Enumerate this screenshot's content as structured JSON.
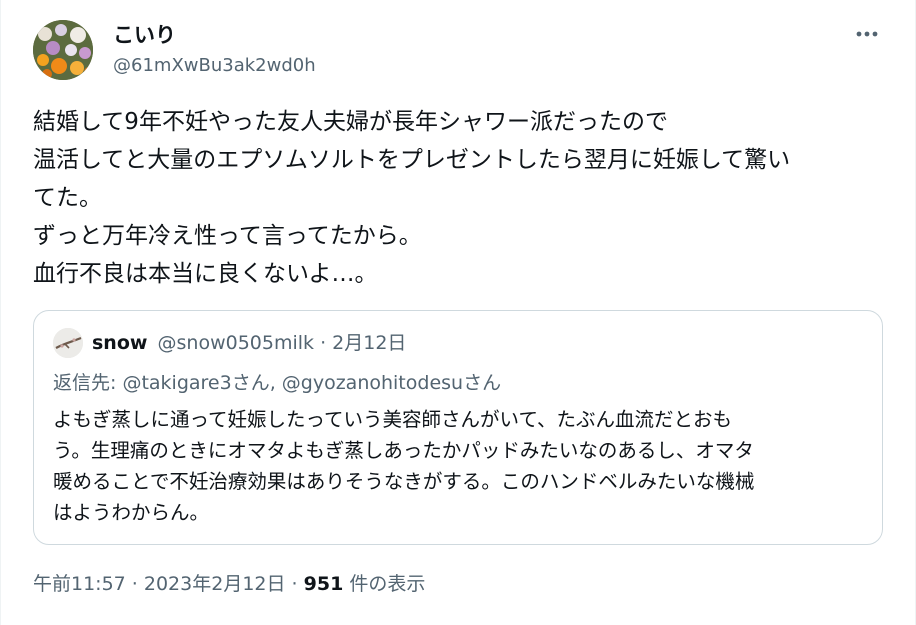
{
  "author": {
    "display_name": "こいり",
    "handle": "@61mXwBu3ak2wd0h"
  },
  "tweet": {
    "lines": [
      "結婚して9年不妊やった友人夫婦が長年シャワー派だったので",
      "温活してと大量のエプソムソルトをプレゼントしたら翌月に妊娠して驚い",
      "てた。",
      "ずっと万年冷え性って言ってたから。",
      "血行不良は本当に良くないよ…。"
    ]
  },
  "quoted_tweet": {
    "display_name": "snow",
    "handle_and_date": "@snow0505milk · 2月12日",
    "reply_to": "返信先: @takigare3さん, @gyozanohitodesuさん",
    "lines": [
      "よもぎ蒸しに通って妊娠したっていう美容師さんがいて、たぶん血流だとおも",
      "う。生理痛のときにオマタよもぎ蒸しあったかパッドみたいなのあるし、オマタ",
      "暖めることで不妊治療効果はありそうなきがする。このハンドベルみたいな機械",
      "はようわからん。"
    ]
  },
  "footer": {
    "timestamp": "午前11:57 · 2023年2月12日",
    "separator": " · ",
    "views_count": "951",
    "views_label": " 件の表示"
  },
  "icons": {
    "more": "more-horizontal-icon",
    "avatar": "flower-photo-avatar",
    "quote_avatar": "branch-photo-avatar"
  },
  "colors": {
    "text": "#0f1419",
    "secondary": "#536471",
    "border": "#cfd9de"
  }
}
